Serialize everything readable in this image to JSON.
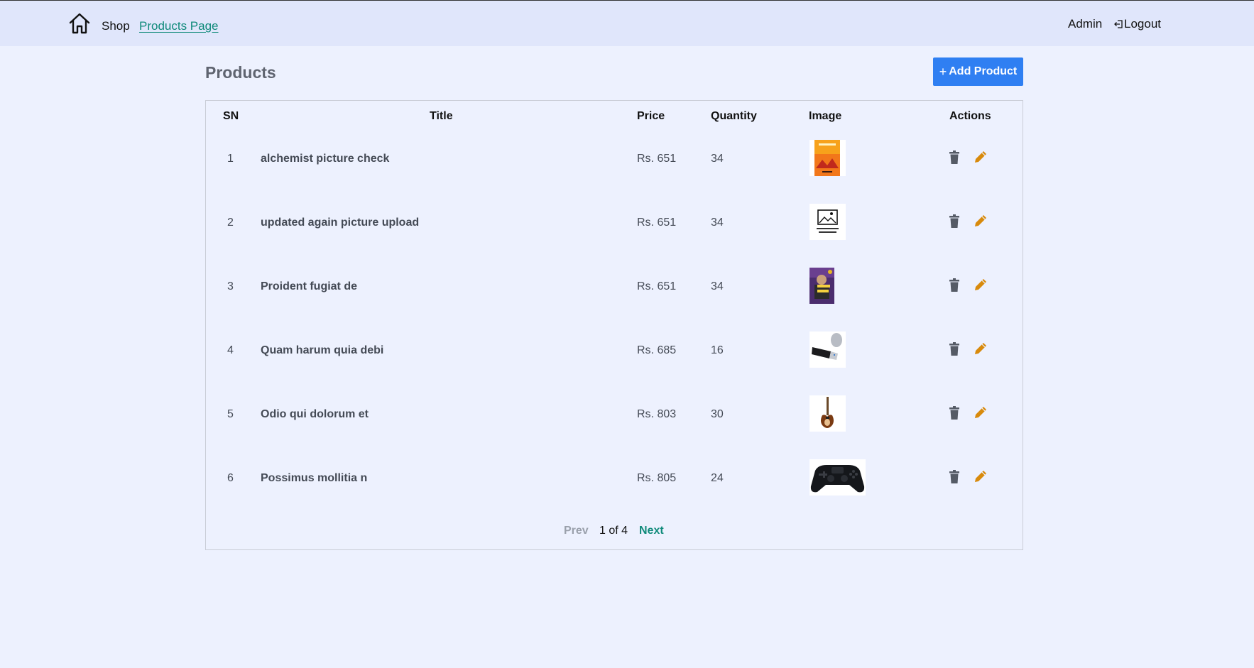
{
  "nav": {
    "home_icon": "home-icon",
    "shop_label": "Shop",
    "products_label": "Products Page",
    "admin_label": "Admin",
    "logout_label": "Logout",
    "logout_icon": "logout-icon",
    "active_color": "#0f8a7a"
  },
  "page": {
    "title": "Products",
    "add_button_label": "Add Product",
    "add_button_icon": "plus",
    "accent": "#2f7ff2"
  },
  "table": {
    "headers": {
      "sn": "SN",
      "title": "Title",
      "price": "Price",
      "quantity": "Quantity",
      "image": "Image",
      "actions": "Actions"
    },
    "rows": [
      {
        "sn": "1",
        "title": "alchemist picture check",
        "price": "Rs. 651",
        "quantity": "34",
        "image": "book-cover-orange"
      },
      {
        "sn": "2",
        "title": "updated again picture upload",
        "price": "Rs. 651",
        "quantity": "34",
        "image": "no-image-available"
      },
      {
        "sn": "3",
        "title": "Proident fugiat de",
        "price": "Rs. 651",
        "quantity": "34",
        "image": "book-cover-purple"
      },
      {
        "sn": "4",
        "title": "Quam harum quia debi",
        "price": "Rs. 685",
        "quantity": "16",
        "image": "usb-drive"
      },
      {
        "sn": "5",
        "title": "Odio qui dolorum et",
        "price": "Rs. 803",
        "quantity": "30",
        "image": "electric-guitar"
      },
      {
        "sn": "6",
        "title": "Possimus mollitia n",
        "price": "Rs. 805",
        "quantity": "24",
        "image": "game-controller"
      }
    ],
    "action_icons": {
      "delete": "trash-icon",
      "edit": "pencil-icon"
    },
    "edit_color": "#d88a0c"
  },
  "pagination": {
    "prev_label": "Prev",
    "page_text": "1 of 4",
    "next_label": "Next"
  },
  "no_image_text": "NO IMAGE AVAILABLE"
}
